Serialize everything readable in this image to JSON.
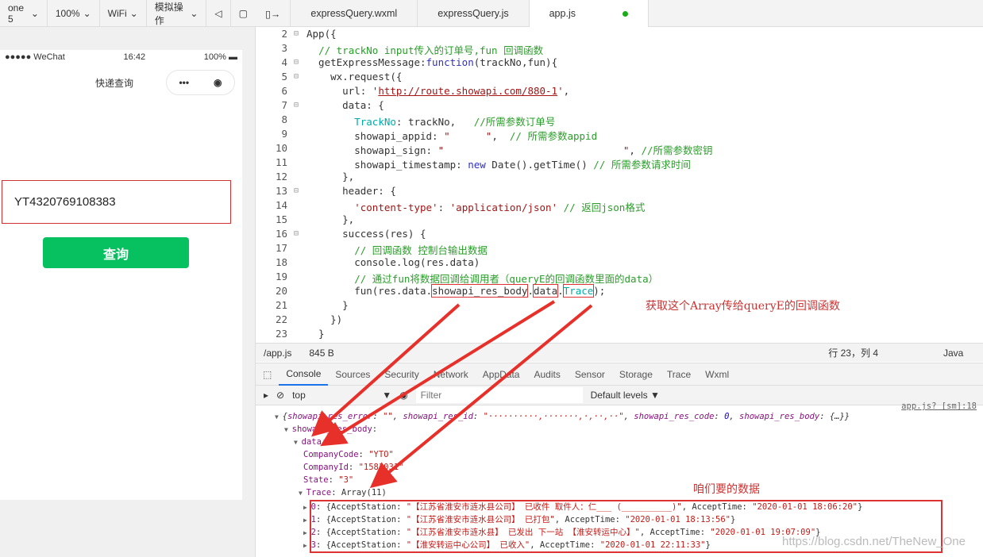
{
  "simulator_toolbar": {
    "device": "one 5",
    "zoom": "100%",
    "network": "WiFi",
    "simulate": "模拟操作"
  },
  "phone": {
    "carrier": "●●●●● WeChat",
    "time": "16:42",
    "battery": "100%",
    "nav_title": "快递查询",
    "input_value": "YT4320769108383",
    "query_button": "查询"
  },
  "editor": {
    "tabs": [
      {
        "label": "expressQuery.wxml"
      },
      {
        "label": "expressQuery.js"
      },
      {
        "label": "app.js"
      }
    ],
    "lines": [
      {
        "n": "2",
        "fold": true,
        "seg": [
          [
            "",
            "App({"
          ]
        ]
      },
      {
        "n": "3",
        "seg": [
          [
            "",
            "  "
          ],
          [
            "cm",
            "// trackNo input传入的订单号,fun 回调函数"
          ]
        ]
      },
      {
        "n": "4",
        "fold": true,
        "seg": [
          [
            "",
            "  getExpressMessage:"
          ],
          [
            "kw",
            "function"
          ],
          [
            "",
            "(trackNo,fun){"
          ]
        ]
      },
      {
        "n": "5",
        "fold": true,
        "seg": [
          [
            "",
            "    wx.request({"
          ]
        ]
      },
      {
        "n": "6",
        "seg": [
          [
            "",
            "      url: '"
          ],
          [
            "url",
            "http://route.showapi.com/880-1"
          ],
          [
            "st",
            "'"
          ],
          [
            "",
            ","
          ]
        ]
      },
      {
        "n": "7",
        "fold": true,
        "seg": [
          [
            "",
            "      data: {"
          ]
        ]
      },
      {
        "n": "8",
        "seg": [
          [
            "",
            "        "
          ],
          [
            "pr",
            "TrackNo"
          ],
          [
            "",
            ": trackNo,   "
          ],
          [
            "cm",
            "//所需参数订单号"
          ]
        ]
      },
      {
        "n": "9",
        "seg": [
          [
            "",
            "        showapi_appid: "
          ],
          [
            "st",
            "\"      \""
          ],
          [
            "",
            ",  "
          ],
          [
            "cm",
            "// 所需参数appid"
          ]
        ]
      },
      {
        "n": "10",
        "seg": [
          [
            "",
            "        showapi_sign: "
          ],
          [
            "st",
            "\"                              \""
          ],
          [
            "",
            ", "
          ],
          [
            "cm",
            "//所需参数密钥"
          ]
        ]
      },
      {
        "n": "11",
        "seg": [
          [
            "",
            "        showapi_timestamp: "
          ],
          [
            "kw",
            "new"
          ],
          [
            "",
            " Date().getTime() "
          ],
          [
            "cm",
            "// 所需参数请求时间"
          ]
        ]
      },
      {
        "n": "12",
        "seg": [
          [
            "",
            "      },"
          ]
        ]
      },
      {
        "n": "13",
        "fold": true,
        "seg": [
          [
            "",
            "      header: {"
          ]
        ]
      },
      {
        "n": "14",
        "seg": [
          [
            "",
            "        "
          ],
          [
            "st",
            "'content-type'"
          ],
          [
            "",
            ": "
          ],
          [
            "st",
            "'application/json'"
          ],
          [
            "",
            " "
          ],
          [
            "cm",
            "// 返回json格式"
          ]
        ]
      },
      {
        "n": "15",
        "seg": [
          [
            "",
            "      },"
          ]
        ]
      },
      {
        "n": "16",
        "fold": true,
        "seg": [
          [
            "",
            "      success(res) {"
          ]
        ]
      },
      {
        "n": "17",
        "seg": [
          [
            "",
            "        "
          ],
          [
            "cm",
            "// 回调函数 控制台输出数据"
          ]
        ]
      },
      {
        "n": "18",
        "seg": [
          [
            "",
            "        console.log(res.data)"
          ]
        ]
      },
      {
        "n": "19",
        "seg": [
          [
            "",
            "        "
          ],
          [
            "cm",
            "// 通过fun将数据回调给调用者（queryE的回调函数里面的data）"
          ]
        ]
      },
      {
        "n": "20",
        "seg": [
          [
            "",
            "        fun(res.data."
          ],
          [
            "bx",
            "showapi_res_body"
          ],
          [
            "",
            "."
          ],
          [
            "bx",
            "data"
          ],
          [
            "",
            "."
          ],
          [
            "bx pr",
            "Trace"
          ],
          [
            "",
            ");"
          ]
        ]
      },
      {
        "n": "21",
        "seg": [
          [
            "",
            "      }"
          ]
        ]
      },
      {
        "n": "22",
        "seg": [
          [
            "",
            "    })"
          ]
        ]
      },
      {
        "n": "23",
        "seg": [
          [
            "",
            "  }"
          ]
        ]
      }
    ],
    "annotation": "获取这个Array传给queryE的回调函数"
  },
  "status_bar": {
    "file": "/app.js",
    "size": "845 B",
    "position": "行 23，列 4",
    "lang": "Java"
  },
  "devtools": {
    "tabs": [
      "Console",
      "Sources",
      "Security",
      "Network",
      "AppData",
      "Audits",
      "Sensor",
      "Storage",
      "Trace",
      "Wxml"
    ],
    "context": "top",
    "filter_placeholder": "Filter",
    "levels": "Default levels ▼",
    "source_link": "app.js? [sm]:18",
    "console": [
      {
        "indent": 0,
        "arrow": "▼",
        "seg": [
          [
            "it",
            "{"
          ],
          [
            "it key",
            "showapi_res_error"
          ],
          [
            "it",
            ": "
          ],
          [
            "it sv",
            "\"\""
          ],
          [
            "it",
            ", "
          ],
          [
            "it key",
            "showapi_res_id"
          ],
          [
            "it",
            ": "
          ],
          [
            "it sv",
            "\"··········,·······,·,··,··\""
          ],
          [
            "it",
            ", "
          ],
          [
            "it key",
            "showapi_res_code"
          ],
          [
            "it",
            ": "
          ],
          [
            "it nv",
            "0"
          ],
          [
            "it",
            ", "
          ],
          [
            "it key",
            "showapi_res_body"
          ],
          [
            "it",
            ": {…}}"
          ]
        ]
      },
      {
        "indent": 1,
        "arrow": "▼",
        "seg": [
          [
            "key",
            "showapi_res_body"
          ],
          [
            "",
            ":"
          ]
        ]
      },
      {
        "indent": 2,
        "arrow": "▼",
        "seg": [
          [
            "key",
            "data"
          ],
          [
            "",
            ":"
          ]
        ]
      },
      {
        "indent": 3,
        "arrow": "",
        "seg": [
          [
            "key",
            "CompanyCode"
          ],
          [
            "",
            ": "
          ],
          [
            "sv",
            "\"YTO\""
          ]
        ]
      },
      {
        "indent": 3,
        "arrow": "",
        "seg": [
          [
            "key",
            "CompanyId"
          ],
          [
            "",
            ": "
          ],
          [
            "sv",
            "\"1581031\""
          ]
        ]
      },
      {
        "indent": 3,
        "arrow": "",
        "seg": [
          [
            "key",
            "State"
          ],
          [
            "",
            ": "
          ],
          [
            "sv",
            "\"3\""
          ]
        ]
      },
      {
        "indent": 2.5,
        "arrow": "▼",
        "seg": [
          [
            "key",
            "Trace"
          ],
          [
            "",
            ": Array(11)"
          ]
        ]
      },
      {
        "indent": 3,
        "arrow": "▶",
        "seg": [
          [
            "key",
            "0"
          ],
          [
            "",
            ": {AcceptStation: "
          ],
          [
            "sv",
            "\"【江苏省淮安市涟水县公司】 已收件 取件人：仁___ (__________)\""
          ],
          [
            "",
            ", AcceptTime: "
          ],
          [
            "sv",
            "\"2020-01-01 18:06:20\""
          ],
          [
            "",
            "}"
          ]
        ]
      },
      {
        "indent": 3,
        "arrow": "▶",
        "seg": [
          [
            "key",
            "1"
          ],
          [
            "",
            ": {AcceptStation: "
          ],
          [
            "sv",
            "\"【江苏省淮安市涟水县公司】 已打包\""
          ],
          [
            "",
            ", AcceptTime: "
          ],
          [
            "sv",
            "\"2020-01-01 18:13:56\""
          ],
          [
            "",
            "}"
          ]
        ]
      },
      {
        "indent": 3,
        "arrow": "▶",
        "seg": [
          [
            "key",
            "2"
          ],
          [
            "",
            ": {AcceptStation: "
          ],
          [
            "sv",
            "\"【江苏省淮安市涟水县】 已发出 下一站 【淮安转运中心】\""
          ],
          [
            "",
            ", AcceptTime: "
          ],
          [
            "sv",
            "\"2020-01-01 19:07:09\""
          ],
          [
            "",
            "}"
          ]
        ]
      },
      {
        "indent": 3,
        "arrow": "▶",
        "seg": [
          [
            "key",
            "3"
          ],
          [
            "",
            ": {AcceptStation: "
          ],
          [
            "sv",
            "\"【淮安转运中心公司】 已收入\""
          ],
          [
            "",
            ", AcceptTime: "
          ],
          [
            "sv",
            "\"2020-01-01 22:11:33\""
          ],
          [
            "",
            "}"
          ]
        ]
      }
    ],
    "annotation": "咱们要的数据"
  },
  "watermark": "https://blog.csdn.net/TheNew_One",
  "colors": {
    "annotation": "#dd3333",
    "button": "#07c160"
  }
}
